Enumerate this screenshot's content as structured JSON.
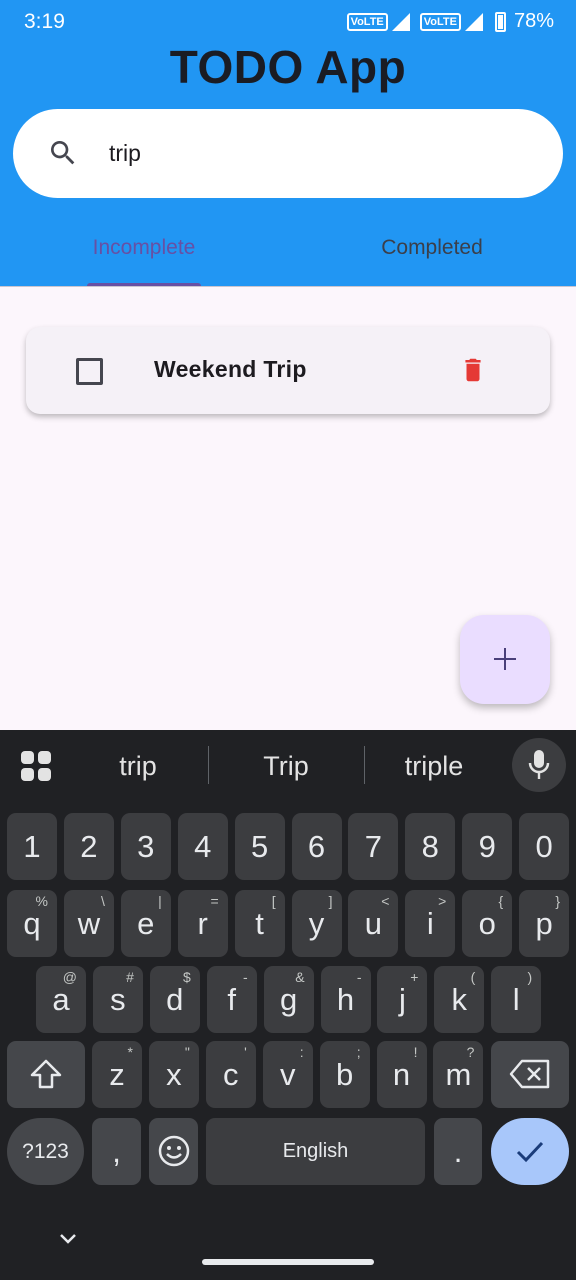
{
  "status": {
    "time": "3:19",
    "volte1": "VoLTE",
    "volte2": "VoLTE",
    "battery": "78%"
  },
  "app": {
    "title": "TODO App"
  },
  "search": {
    "value": "trip",
    "placeholder": ""
  },
  "tabs": [
    {
      "label": "Incomplete",
      "selected": true
    },
    {
      "label": "Completed",
      "selected": false
    }
  ],
  "tasks": [
    {
      "title": "Weekend Trip",
      "done": false
    }
  ],
  "colors": {
    "header": "#2196f3",
    "accent": "#6750a4",
    "delete": "#e53935",
    "fab": "#eaddff"
  },
  "keyboard": {
    "suggestions": [
      "trip",
      "Trip",
      "triple"
    ],
    "row_numbers": [
      "1",
      "2",
      "3",
      "4",
      "5",
      "6",
      "7",
      "8",
      "9",
      "0"
    ],
    "row1": [
      {
        "k": "q",
        "h": "%"
      },
      {
        "k": "w",
        "h": "\\"
      },
      {
        "k": "e",
        "h": "|"
      },
      {
        "k": "r",
        "h": "="
      },
      {
        "k": "t",
        "h": "["
      },
      {
        "k": "y",
        "h": "]"
      },
      {
        "k": "u",
        "h": "<"
      },
      {
        "k": "i",
        "h": ">"
      },
      {
        "k": "o",
        "h": "{"
      },
      {
        "k": "p",
        "h": "}"
      }
    ],
    "row2": [
      {
        "k": "a",
        "h": "@"
      },
      {
        "k": "s",
        "h": "#"
      },
      {
        "k": "d",
        "h": "$"
      },
      {
        "k": "f",
        "h": "-"
      },
      {
        "k": "g",
        "h": "&"
      },
      {
        "k": "h",
        "h": "-"
      },
      {
        "k": "j",
        "h": "+"
      },
      {
        "k": "k",
        "h": "("
      },
      {
        "k": "l",
        "h": ")"
      }
    ],
    "row3": [
      {
        "k": "z",
        "h": "*"
      },
      {
        "k": "x",
        "h": "\""
      },
      {
        "k": "c",
        "h": "'"
      },
      {
        "k": "v",
        "h": ":"
      },
      {
        "k": "b",
        "h": ";"
      },
      {
        "k": "n",
        "h": "!"
      },
      {
        "k": "m",
        "h": "?"
      }
    ],
    "symbols_label": "?123",
    "comma": ",",
    "space_label": "English",
    "period": ".",
    "icons": [
      "apps-grid-icon",
      "mic-icon",
      "shift-icon",
      "backspace-icon",
      "emoji-icon",
      "checkmark-icon",
      "chevron-down-icon"
    ]
  }
}
